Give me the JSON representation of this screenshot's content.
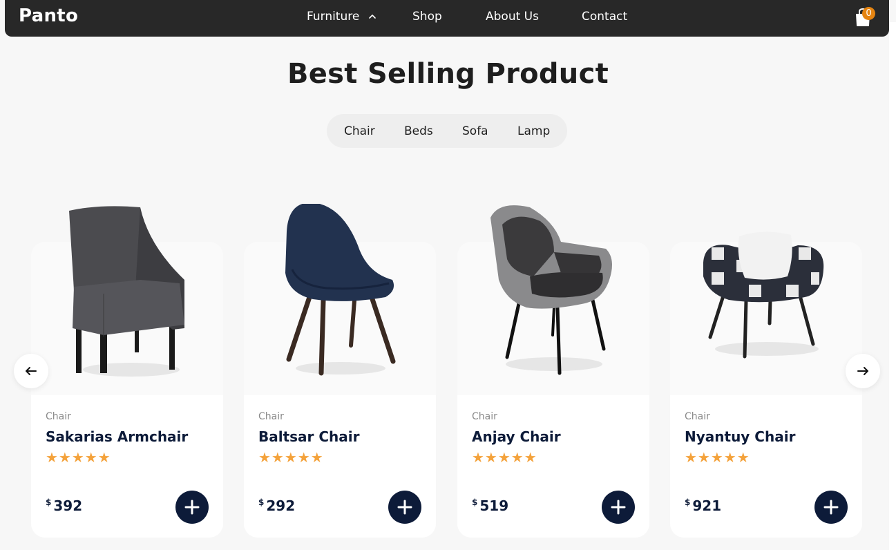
{
  "brand": "Panto",
  "nav": {
    "links": [
      "Furniture",
      "Shop",
      "About Us",
      "Contact"
    ],
    "cart_count": "0"
  },
  "section": {
    "title": "Best Selling Product",
    "tabs": [
      "Chair",
      "Beds",
      "Sofa",
      "Lamp"
    ]
  },
  "products": [
    {
      "category": "Chair",
      "name": "Sakarias Armchair",
      "stars": "★★★★★",
      "rating": 5,
      "currency": "$",
      "price": "392"
    },
    {
      "category": "Chair",
      "name": "Baltsar Chair",
      "stars": "★★★★★",
      "rating": 5,
      "currency": "$",
      "price": "292"
    },
    {
      "category": "Chair",
      "name": "Anjay Chair",
      "stars": "★★★★★",
      "rating": 5,
      "currency": "$",
      "price": "519"
    },
    {
      "category": "Chair",
      "name": "Nyantuy Chair",
      "stars": "★★★★★",
      "rating": 5,
      "currency": "$",
      "price": "921"
    }
  ],
  "colors": {
    "navbar": "#282828",
    "accent_badge": "#e58411",
    "navy": "#0d1b39",
    "star": "#f4a23b",
    "background": "#f7f7f7"
  },
  "icons": [
    "chevron-up-icon",
    "shopping-bag-icon",
    "arrow-left-icon",
    "arrow-right-icon",
    "plus-icon"
  ]
}
